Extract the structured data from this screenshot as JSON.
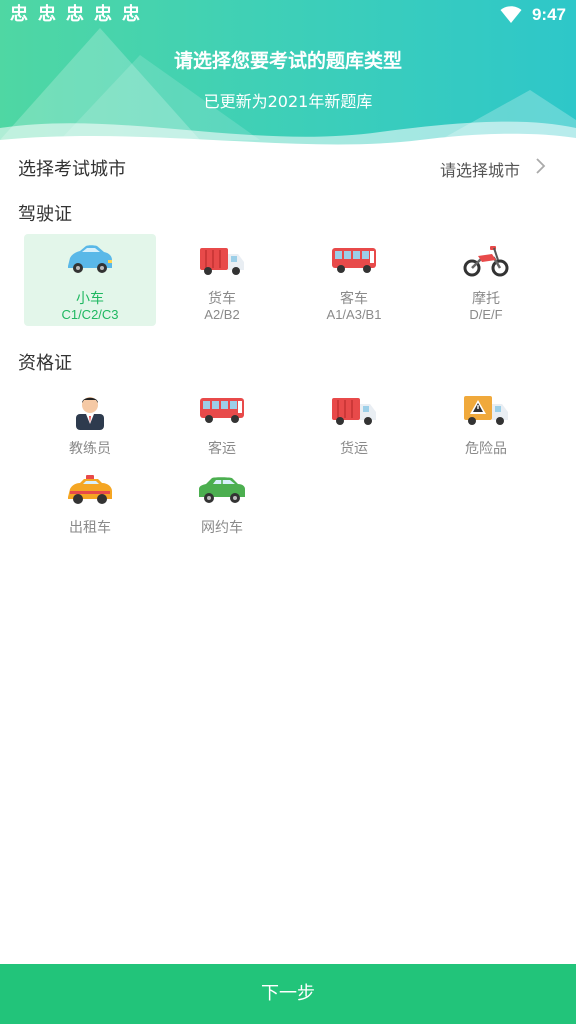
{
  "header": {
    "title": "请选择您要考试的题库类型",
    "subtitle": "已更新为2021年新题库"
  },
  "status_bar": {
    "time": "9:47",
    "notification_icons": [
      "notify-icon",
      "notify-icon",
      "notify-icon",
      "notify-icon",
      "notify-icon"
    ],
    "notification_glyph": "忠"
  },
  "city": {
    "label": "选择考试城市",
    "value": "请选择城市"
  },
  "driving": {
    "title": "驾驶证",
    "items": [
      {
        "label": "小车",
        "sub": "C1/C2/C3",
        "icon": "car-icon",
        "selected": true
      },
      {
        "label": "货车",
        "sub": "A2/B2",
        "icon": "truck-icon",
        "selected": false
      },
      {
        "label": "客车",
        "sub": "A1/A3/B1",
        "icon": "bus-icon",
        "selected": false
      },
      {
        "label": "摩托",
        "sub": "D/E/F",
        "icon": "motorcycle-icon",
        "selected": false
      }
    ]
  },
  "qualification": {
    "title": "资格证",
    "items": [
      {
        "label": "教练员",
        "icon": "coach-icon"
      },
      {
        "label": "客运",
        "icon": "bus-icon"
      },
      {
        "label": "货运",
        "icon": "truck-icon"
      },
      {
        "label": "危险品",
        "icon": "hazard-truck-icon"
      },
      {
        "label": "出租车",
        "icon": "taxi-icon"
      },
      {
        "label": "网约车",
        "icon": "car-icon"
      }
    ]
  },
  "footer": {
    "next_label": "下一步"
  },
  "colors": {
    "accent": "#22c47a",
    "selected_bg": "#e3f6ea",
    "selected_text": "#1fb861"
  }
}
